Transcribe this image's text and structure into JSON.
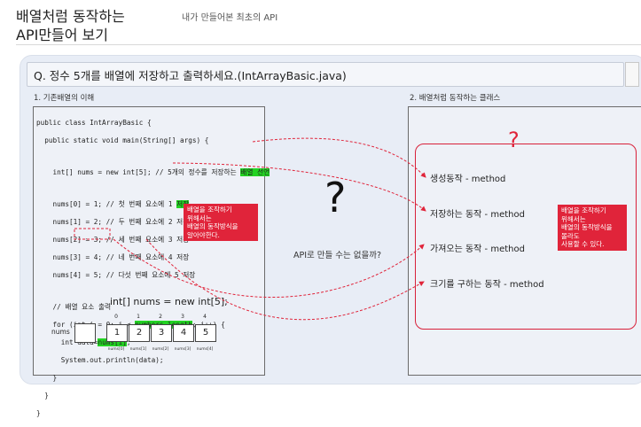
{
  "slide": {
    "title_line1": "배열처럼 동작하는",
    "title_line2": "API만들어 보기",
    "subtitle": "내가 만들어본 최초의 API"
  },
  "question": "Q. 정수 5개를 배열에 저장하고 출력하세요.(IntArrayBasic.java)",
  "left_section": {
    "label": "1. 기존배열의 이해",
    "code": {
      "l1": "public class IntArrayBasic {",
      "l2": "  public static void main(String[] args) {",
      "l3_pre": "    int[] nums = new int[5]; // 5개의 정수를 저장하는 ",
      "l3_hl": "배열 선언",
      "l4_pre": "    nums[0] = 1; // 첫 번째 요소에 1 ",
      "l4_hl": "저장",
      "l5": "    nums[1] = 2; // 두 번째 요소에 2 저장",
      "l6": "    nums[2] = 3; // 세 번째 요소에 3 저장",
      "l7": "    nums[3] = 4; // 네 번째 요소에 4 저장",
      "l8": "    nums[4] = 5; // 다섯 번째 요소에 5 저장",
      "l9": "    // 배열 요소 출력",
      "l10_pre": "    for (int i = 0; i < ",
      "l10_hl": "numbers.length",
      "l10_post": "; i++) {",
      "l11_pre": "      int data=",
      "l11_hl": "nums[i]",
      "l11_post": ";",
      "l12": "      System.out.println(data);",
      "l13": "    }",
      "l14": "  }",
      "l15": "}"
    },
    "note": {
      "line1": "배열을 조작하기",
      "line2": "위해서는",
      "line3": "배열의 동작방식을",
      "line4": "알아야한다."
    },
    "array": {
      "declaration": "int[] nums = new int[5];",
      "var_label": "nums",
      "indices": [
        "0",
        "1",
        "2",
        "3",
        "4"
      ],
      "values": [
        "1",
        "2",
        "3",
        "4",
        "5"
      ],
      "subs": [
        "nums[0]",
        "nums[1]",
        "nums[2]",
        "nums[3]",
        "nums[4]"
      ]
    }
  },
  "center": {
    "big_question": "?",
    "api_question": "API로 만들 수는 없을까?"
  },
  "right_section": {
    "label": "2. 배열처럼 동작하는 클래스",
    "question_mark": "?",
    "methods": [
      "생성동작 - method",
      "저장하는 동작 - method",
      "가져오는 동작 - method",
      "크기를 구하는 동작 - method"
    ],
    "note": {
      "line1": "배열을 조작하기",
      "line2": "위해서는",
      "line3": "배열의 동작방식을",
      "line4": "몰라도",
      "line5": "사용할 수 있다."
    }
  },
  "colors": {
    "accent_red": "#e0243a",
    "highlight_green": "#22d322",
    "panel_bg": "#e8edf6"
  }
}
